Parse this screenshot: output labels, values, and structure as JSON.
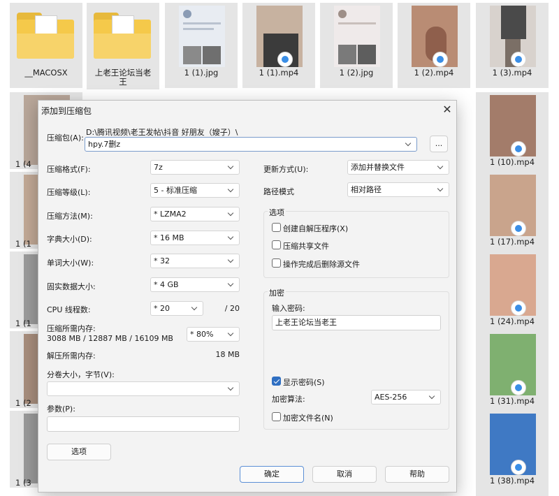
{
  "explorer": {
    "top_row": [
      {
        "label": "__MACOSX",
        "kind": "folder"
      },
      {
        "label": "上老王论坛当老\n王",
        "kind": "folder"
      },
      {
        "label": "1 (1).jpg",
        "kind": "image",
        "color": "#8a9bb4"
      },
      {
        "label": "1 (1).mp4",
        "kind": "video",
        "color": "#4a4a4a"
      },
      {
        "label": "1 (2).jpg",
        "kind": "image",
        "color": "#9e8f88"
      },
      {
        "label": "1 (2).mp4",
        "kind": "video",
        "color": "#b98c74"
      },
      {
        "label": "1 (3).mp4",
        "kind": "video",
        "color": "#6b6b6b"
      }
    ],
    "right_column": [
      {
        "label": "1 (10).mp4",
        "color": "#a37c6a"
      },
      {
        "label": "1 (17).mp4",
        "color": "#c9a48c"
      },
      {
        "label": "1 (24).mp4",
        "color": "#d9a890"
      },
      {
        "label": "1 (31).mp4",
        "color": "#7fb070"
      },
      {
        "label": "1 (38).mp4",
        "color": "#3f79c4"
      }
    ],
    "left_partial": [
      "1 (4",
      "1 (1",
      "1 (1",
      "1 (2",
      "1 (3"
    ]
  },
  "dialog": {
    "title": "添加到压缩包",
    "archive_label": "压缩包(A):",
    "archive_path": "D:\\腾讯视频\\老王发帖\\抖音 好朋友（嫂子）\\",
    "archive_name": "hpy.7删z",
    "browse_label": "...",
    "format_label": "压缩格式(F):",
    "format_value": "7z",
    "level_label": "压缩等级(L):",
    "level_value": "5 - 标准压缩",
    "method_label": "压缩方法(M):",
    "method_value": "* LZMA2",
    "dict_label": "字典大小(D):",
    "dict_value": "* 16 MB",
    "word_label": "单词大小(W):",
    "word_value": "* 32",
    "solid_label": "固实数据大小:",
    "solid_value": "* 4 GB",
    "cpu_label": "CPU 线程数:",
    "cpu_value": "* 20",
    "cpu_total": "/ 20",
    "mem_label": "压缩所需内存:",
    "mem_detail": "3088 MB / 12887 MB / 16109 MB",
    "mem_value": "* 80%",
    "decomp_label": "解压所需内存:",
    "decomp_value": "18 MB",
    "split_label": "分卷大小，字节(V):",
    "split_value": "",
    "params_label": "参数(P):",
    "params_value": "",
    "options_button": "选项",
    "update_label": "更新方式(U):",
    "update_value": "添加并替换文件",
    "path_label": "路径模式",
    "path_value": "相对路径",
    "options_group": "选项",
    "opt_sfx": "创建自解压程序(X)",
    "opt_shared": "压缩共享文件",
    "opt_delete": "操作完成后删除源文件",
    "enc_group": "加密",
    "pw_label": "输入密码:",
    "pw_value": "上老王论坛当老王",
    "show_pw": "显示密码(S)",
    "enc_method_label": "加密算法:",
    "enc_method_value": "AES-256",
    "enc_names": "加密文件名(N)",
    "ok": "确定",
    "cancel": "取消",
    "help": "帮助"
  }
}
